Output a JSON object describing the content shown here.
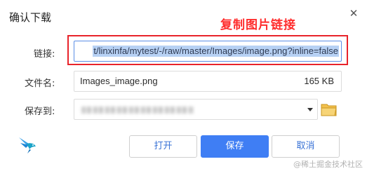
{
  "dialog": {
    "title": "确认下载",
    "close_glyph": "✕"
  },
  "annotation": {
    "text": "复制图片链接",
    "color": "#ff2d2d"
  },
  "fields": {
    "link_label": "链接:",
    "link_value": "t/linxinfa/mytest/-/raw/master/Images/image.png?inline=false",
    "filename_label": "文件名:",
    "filename_value": "Images_image.png",
    "filesize": "165 KB",
    "saveto_label": "保存到:"
  },
  "icons": {
    "folder": "folder-icon",
    "logo": "bird-logo-icon",
    "dropdown": "chevron-down-icon"
  },
  "buttons": {
    "open": "打开",
    "save": "保存",
    "cancel": "取消"
  },
  "watermark": "@稀土掘金技术社区",
  "colors": {
    "primary": "#3f7ef4",
    "annotation_border": "#e8232b",
    "selection": "#b7d1f4"
  }
}
